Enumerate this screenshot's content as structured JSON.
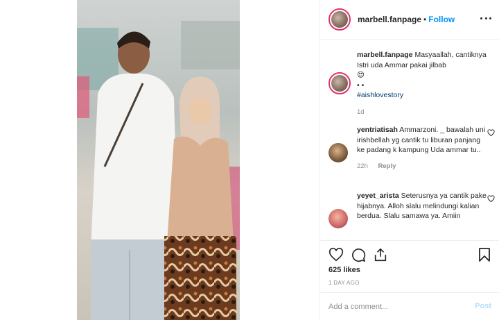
{
  "post": {
    "username": "marbell.fanpage",
    "separator": "•",
    "follow_label": "Follow",
    "more_icon": "more-options-icon"
  },
  "caption": {
    "username": "marbell.fanpage",
    "text": "Masyaallah, cantiknya Istri uda Ammar pakai jilbab",
    "emoji": "😍",
    "dots": "• •",
    "hashtag": "#aishlovestory",
    "time": "1d"
  },
  "comments": [
    {
      "username": "yentriatisah",
      "text": "Ammarzoni. _ bawalah uni irishbellah yg cantik tu liburan panjang ke padang k kampung Uda ammar tu..",
      "time": "22h",
      "reply_label": "Reply"
    },
    {
      "username": "yeyet_arista",
      "text": "Seterusnya ya cantik pake hijabnya. Alloh slalu melindungi kalian berdua. Slalu samawa ya. Amiin"
    }
  ],
  "actions": {
    "likes": "625 likes",
    "age": "1 DAY AGO"
  },
  "add_comment": {
    "placeholder": "Add a comment...",
    "post_label": "Post"
  },
  "colors": {
    "accent": "#0095f6",
    "post_disabled": "#b2dffc",
    "hashtag": "#00376b",
    "muted": "#8e8e8e"
  }
}
